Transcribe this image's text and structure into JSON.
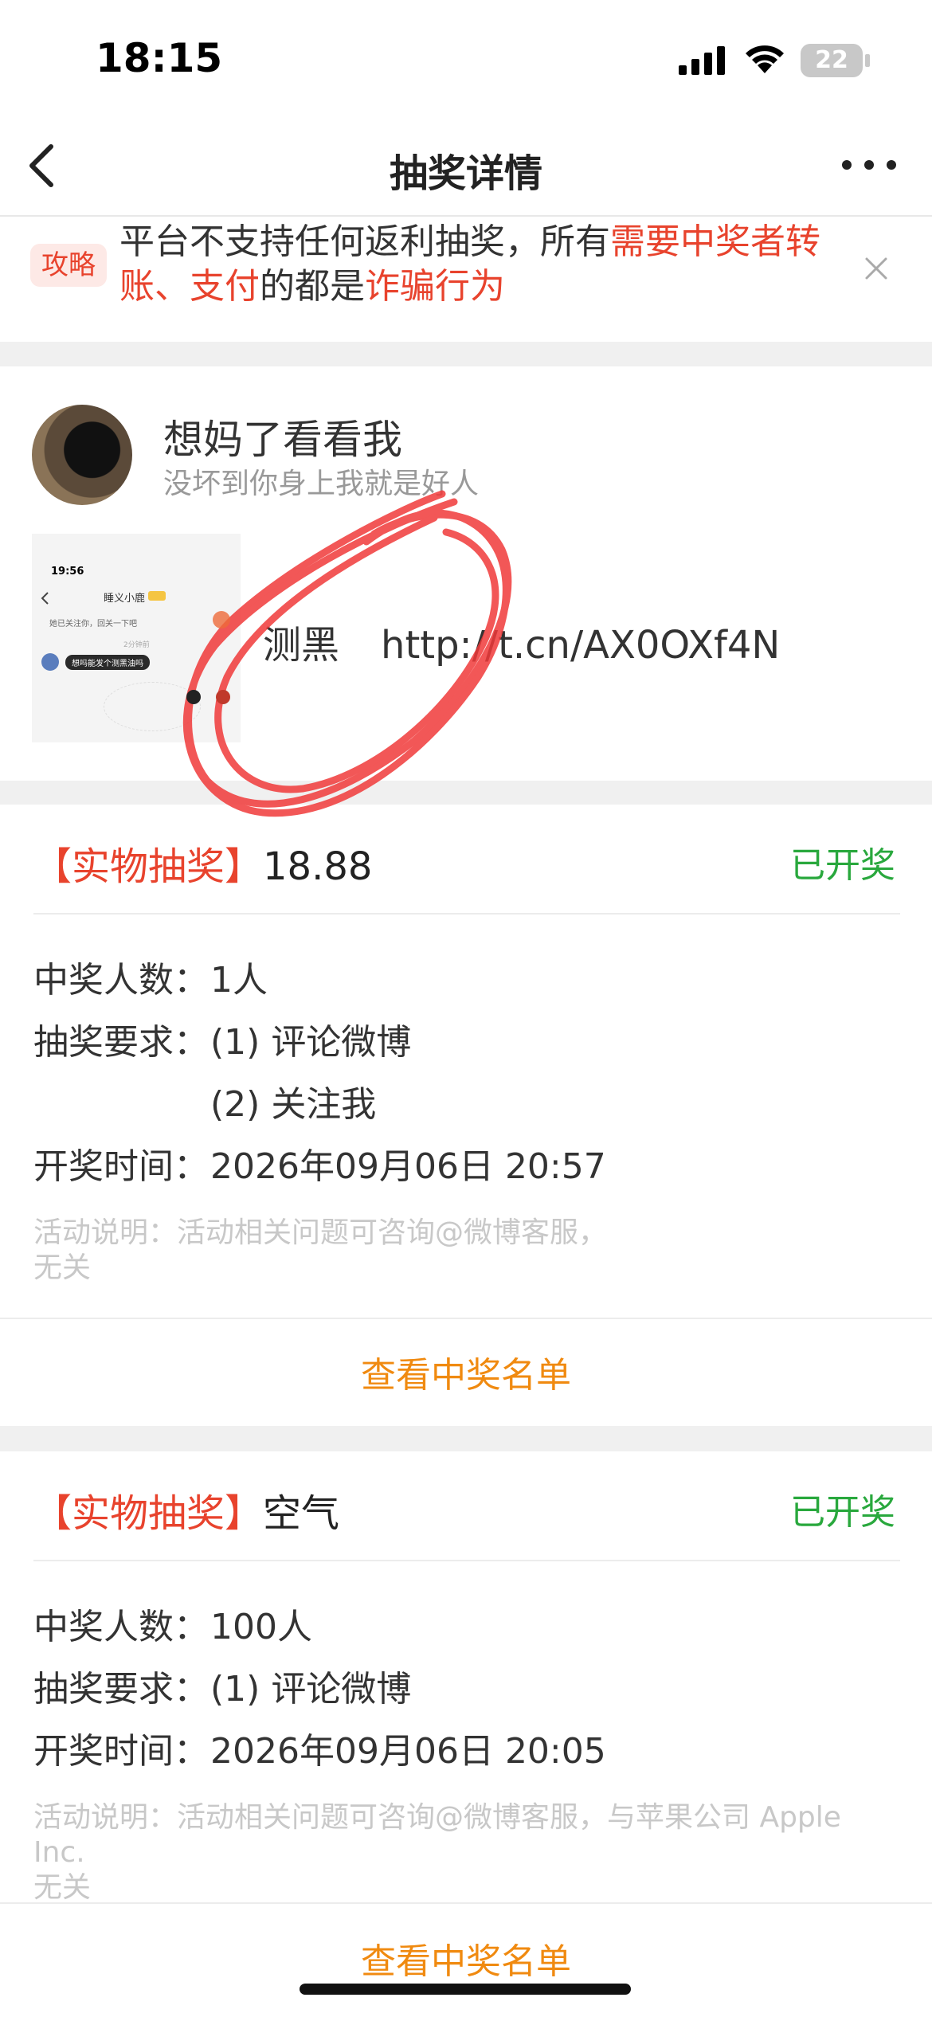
{
  "status_bar": {
    "time": "18:15",
    "battery": "22",
    "icons": [
      "signal-icon",
      "wifi-icon",
      "battery-icon"
    ]
  },
  "nav": {
    "title": "抽奖详情",
    "back_icon": "chevron-left-icon",
    "more_icon": "more-dots-icon"
  },
  "warning": {
    "badge": "攻略",
    "text_1": "平台不支持任何返利抽奖，所有",
    "text_red_1": "需要中奖者转账、支付",
    "text_2": "的都是",
    "text_red_2": "诈骗行为",
    "close_icon": "close-icon"
  },
  "post": {
    "name": "想妈了看看我",
    "subtitle": "没坏到你身上我就是好人",
    "link_text": "测黑",
    "link_url": "http://t.cn/AX0OXf4N",
    "thumb": {
      "time": "19:56",
      "title": "睡义小鹿",
      "line1": "她已关注你，回关一下吧",
      "meta": "2分钟前",
      "bubble": "想吗能发个测黑油吗"
    }
  },
  "lotteries": [
    {
      "tag": "【实物抽奖】",
      "prize": "18.88",
      "status": "已开奖",
      "winners_label": "中奖人数：",
      "winners": "1人",
      "req_label": "抽奖要求：",
      "requirements": [
        "(1) 评论微博",
        "(2) 关注我"
      ],
      "time_label": "开奖时间：",
      "time": "2026年09月06日 20:57",
      "note_1": "活动说明：活动相关问题可咨询@微博客服，",
      "note_2": "无关",
      "view_link": "查看中奖名单"
    },
    {
      "tag": "【实物抽奖】",
      "prize": "空气",
      "status": "已开奖",
      "winners_label": "中奖人数：",
      "winners": "100人",
      "req_label": "抽奖要求：",
      "requirements": [
        "(1) 评论微博"
      ],
      "time_label": "开奖时间：",
      "time": "2026年09月06日 20:05",
      "note_1": "活动说明：活动相关问题可咨询@微博客服，与苹果公司 Apple Inc.",
      "note_2": "无关",
      "view_link": "查看中奖名单"
    }
  ],
  "colors": {
    "accent_red": "#e8432d",
    "status_green": "#29a83d",
    "link_orange": "#f08a10",
    "annotation_red": "#f03a3a"
  }
}
